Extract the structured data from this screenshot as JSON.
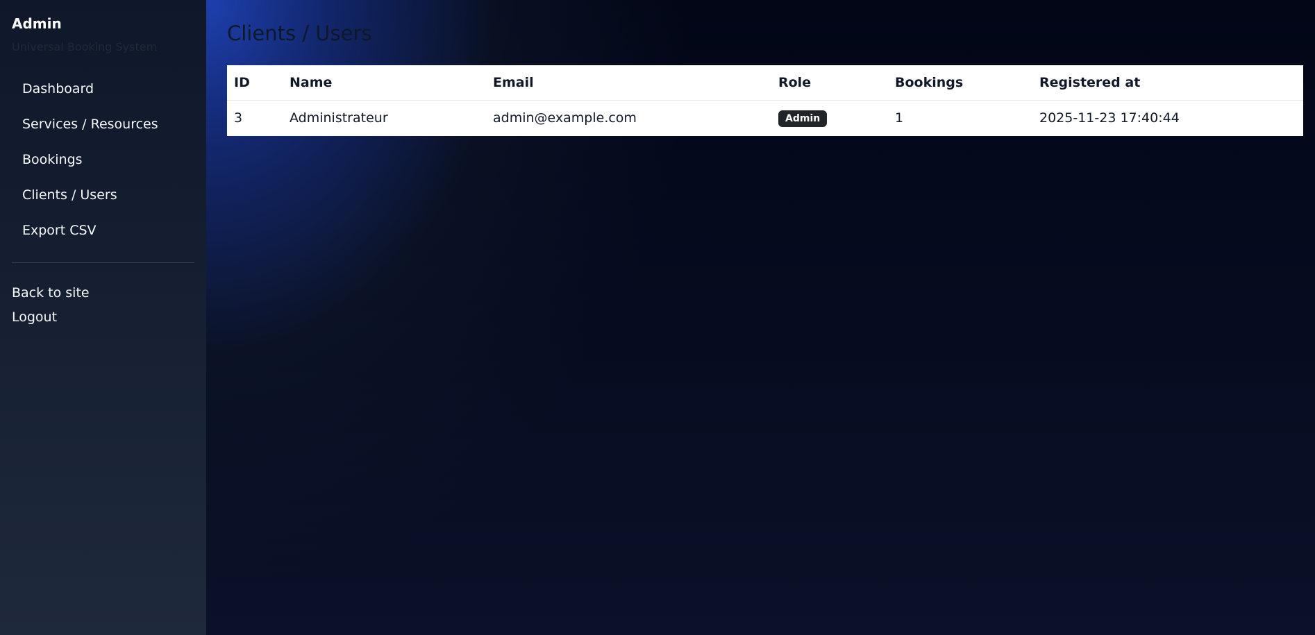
{
  "sidebar": {
    "title": "Admin",
    "subtitle": "Universal Booking System",
    "nav": [
      {
        "label": "Dashboard"
      },
      {
        "label": "Services / Resources"
      },
      {
        "label": "Bookings"
      },
      {
        "label": "Clients / Users"
      },
      {
        "label": "Export CSV"
      }
    ],
    "back_label": "Back to site",
    "logout_label": "Logout"
  },
  "main": {
    "title": "Clients / Users",
    "table": {
      "columns": [
        "ID",
        "Name",
        "Email",
        "Role",
        "Bookings",
        "Registered at"
      ],
      "rows": [
        {
          "id": "3",
          "name": "Administrateur",
          "email": "admin@example.com",
          "role": "Admin",
          "bookings": "1",
          "registered_at": "2025-11-23 17:40:44"
        }
      ]
    }
  },
  "colors": {
    "sidebar_bg": "#1e293b",
    "main_accent": "#1e40af",
    "badge_bg": "#212529"
  }
}
